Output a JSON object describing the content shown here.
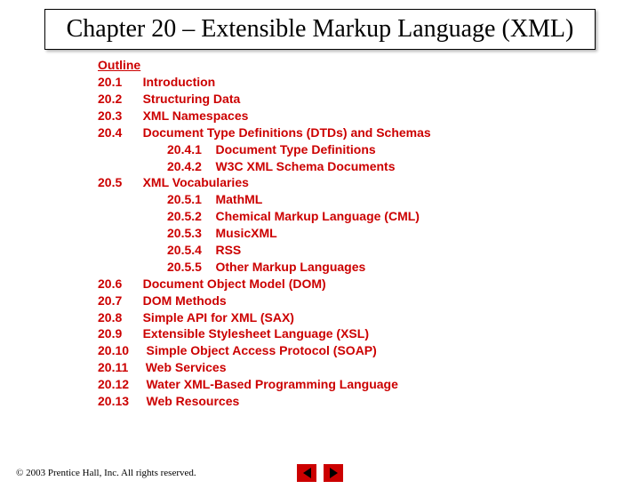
{
  "title": "Chapter 20 – Extensible Markup Language (XML)",
  "outline_heading": "Outline",
  "sections": [
    {
      "num": "20.1",
      "title": "Introduction"
    },
    {
      "num": "20.2",
      "title": "Structuring Data"
    },
    {
      "num": "20.3",
      "title": "XML Namespaces"
    },
    {
      "num": "20.4",
      "title": "Document Type Definitions (DTDs) and Schemas",
      "subs": [
        {
          "num": "20.4.1",
          "title": "Document Type Definitions"
        },
        {
          "num": "20.4.2",
          "title": "W3C XML Schema Documents"
        }
      ]
    },
    {
      "num": "20.5",
      "title": "XML Vocabularies",
      "subs": [
        {
          "num": "20.5.1",
          "title": "MathML"
        },
        {
          "num": "20.5.2",
          "title": "Chemical Markup Language (CML)"
        },
        {
          "num": "20.5.3",
          "title": "MusicXML"
        },
        {
          "num": "20.5.4",
          "title": "RSS"
        },
        {
          "num": "20.5.5",
          "title": "Other Markup Languages"
        }
      ]
    },
    {
      "num": "20.6",
      "title": "Document Object Model (DOM)"
    },
    {
      "num": "20.7",
      "title": "DOM Methods"
    },
    {
      "num": "20.8",
      "title": "Simple API for XML (SAX)"
    },
    {
      "num": "20.9",
      "title": "Extensible Stylesheet Language (XSL)"
    },
    {
      "num": "20.10",
      "title": "Simple Object Access Protocol (SOAP)"
    },
    {
      "num": "20.11",
      "title": "Web Services"
    },
    {
      "num": "20.12",
      "title": "Water XML-Based Programming Language"
    },
    {
      "num": "20.13",
      "title": "Web Resources"
    }
  ],
  "copyright": "© 2003 Prentice Hall, Inc.  All rights reserved."
}
